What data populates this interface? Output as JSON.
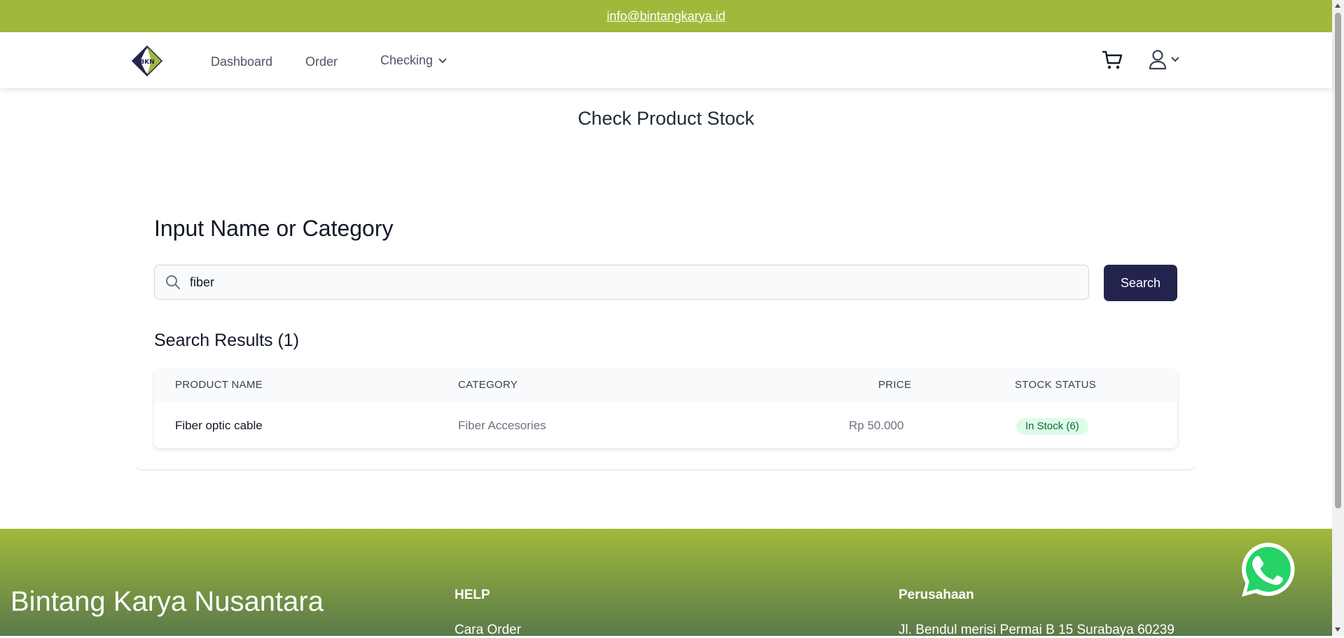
{
  "topbar": {
    "email": "info@bintangkarya.id"
  },
  "nav": {
    "logo_text": "BKN",
    "items": [
      {
        "label": "Dashboard"
      },
      {
        "label": "Order"
      },
      {
        "label": "Checking"
      }
    ],
    "icons": [
      "cart-icon",
      "user-icon",
      "chevron-down-icon"
    ]
  },
  "page": {
    "title": "Check Product Stock"
  },
  "search": {
    "heading": "Input Name or Category",
    "value": "fiber",
    "button_label": "Search"
  },
  "results": {
    "heading": "Search Results (1)",
    "columns": [
      "PRODUCT NAME",
      "CATEGORY",
      "PRICE",
      "STOCK STATUS"
    ],
    "rows": [
      {
        "product": "Fiber optic cable",
        "category": "Fiber Accesories",
        "price": "Rp 50.000",
        "stock": "In Stock (6)"
      }
    ]
  },
  "footer": {
    "brand": "Bintang Karya Nusantara",
    "help_heading": "HELP",
    "help_link": "Cara Order",
    "company_heading": "Perusahaan",
    "address": "Jl. Bendul merisi Permai B 15 Surabaya 60239"
  },
  "colors": {
    "brand_green": "#a1b93b",
    "navy": "#23244e",
    "stock_bg": "#dcfce7",
    "stock_text": "#166534"
  }
}
